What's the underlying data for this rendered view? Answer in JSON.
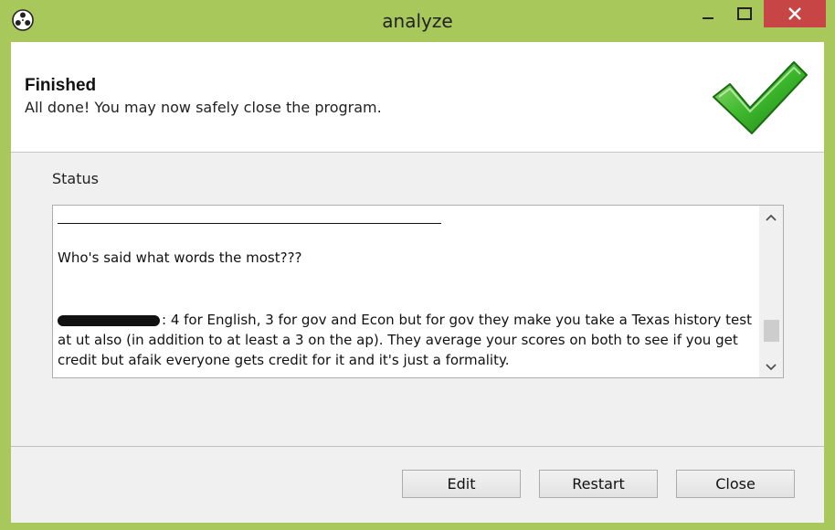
{
  "window": {
    "title": "analyze",
    "app_icon": "film-reel-icon",
    "close_color": "#c84545",
    "frame_color": "#a8c85c"
  },
  "header": {
    "title": "Finished",
    "subtitle": "All done! You may now safely close the program.",
    "icon": "green-checkmark-icon"
  },
  "status": {
    "label": "Status",
    "heading": "Who's said what words the most???",
    "body": ": 4 for English, 3 for gov and Econ but for gov they make you take a Texas history test at ut also (in addition to at least a 3 on the ap). They average your scores on both to see if you get credit but afaik everyone gets credit for it and it's just a formality."
  },
  "buttons": {
    "edit": "Edit",
    "restart": "Restart",
    "close": "Close"
  }
}
